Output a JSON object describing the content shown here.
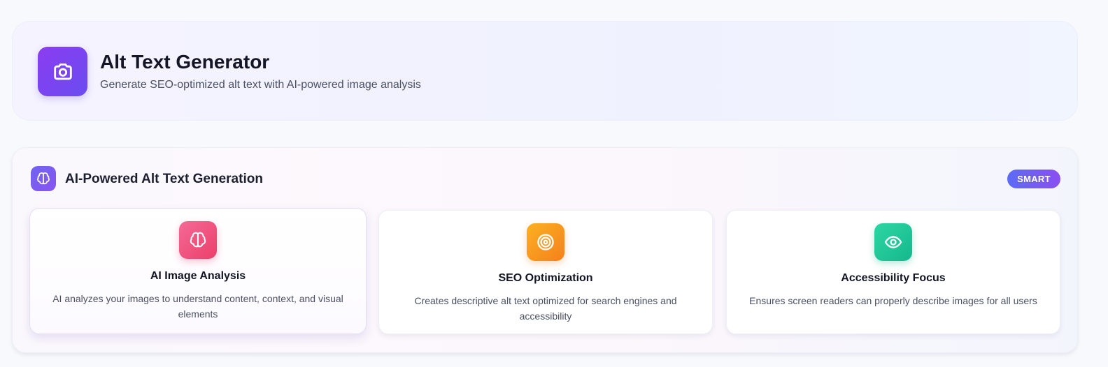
{
  "header": {
    "title": "Alt Text Generator",
    "subtitle": "Generate SEO-optimized alt text with AI-powered image analysis",
    "icon": "camera-icon",
    "accent": "#7c3aed"
  },
  "feature_panel": {
    "title": "AI-Powered Alt Text Generation",
    "icon": "brain-icon",
    "badge": "SMART",
    "cards": [
      {
        "title": "AI Image Analysis",
        "description": "AI analyzes your images to understand content, context, and visual elements",
        "icon": "brain-icon",
        "color": "#ec4870"
      },
      {
        "title": "SEO Optimization",
        "description": "Creates descriptive alt text optimized for search engines and accessibility",
        "icon": "target-icon",
        "color": "#f7911e"
      },
      {
        "title": "Accessibility Focus",
        "description": "Ensures screen readers can properly describe images for all users",
        "icon": "eye-icon",
        "color": "#19c394"
      }
    ]
  }
}
